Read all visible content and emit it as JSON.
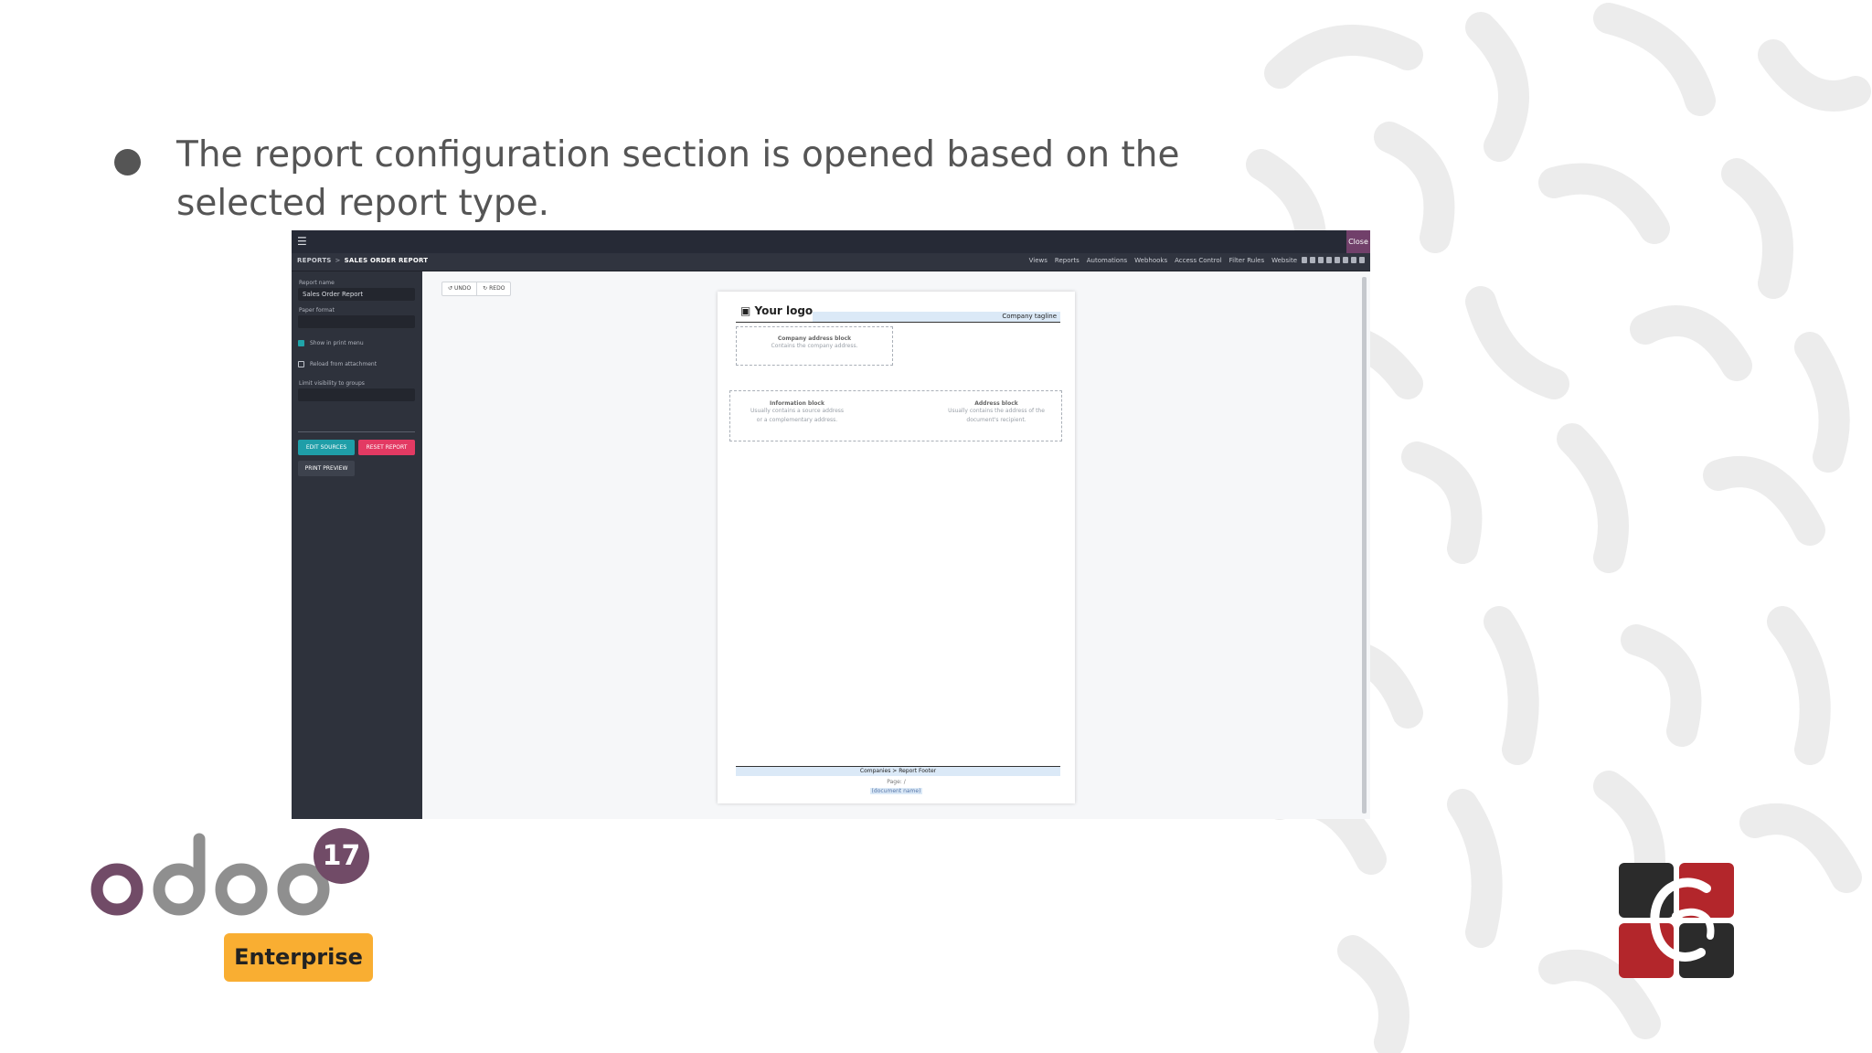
{
  "slide": {
    "bullet_text": "The report configuration section is opened based on the selected report type."
  },
  "topbar": {
    "close_label": "Close"
  },
  "breadcrumb": {
    "parent": "REPORTS",
    "current": "SALES ORDER REPORT"
  },
  "studio_nav": [
    "Views",
    "Reports",
    "Automations",
    "Webhooks",
    "Access Control",
    "Filter Rules",
    "Website"
  ],
  "sidebar": {
    "report_name_label": "Report name",
    "report_name_value": "Sales Order Report",
    "paper_format_label": "Paper format",
    "paper_format_value": "",
    "show_in_print_menu": "Show in print menu",
    "reload_from_attachment": "Reload from attachment",
    "limit_visibility_label": "Limit visibility to groups",
    "edit_sources": "EDIT SOURCES",
    "reset_report": "RESET REPORT",
    "print_preview": "PRINT PREVIEW"
  },
  "toolbar": {
    "undo": "UNDO",
    "redo": "REDO"
  },
  "report_page": {
    "logo": "Your logo",
    "tagline": "Company tagline",
    "company_address_title": "Company address block",
    "company_address_desc": "Contains the company address.",
    "info_title": "Information block",
    "info_desc": "Usually contains a source address or a complementary address.",
    "address_title": "Address block",
    "address_desc": "Usually contains the address of the document's recipient.",
    "footer": "Companies > Report Footer",
    "page": "Page: /",
    "doc_name": "(document name)"
  },
  "branding": {
    "version": "17",
    "edition": "Enterprise"
  },
  "colors": {
    "odoo_purple": "#714b67",
    "odoo_grey": "#8f8f8f",
    "enterprise_orange": "#f9ae32",
    "teal_button": "#1f9ea8",
    "pink_button": "#e33a63"
  }
}
